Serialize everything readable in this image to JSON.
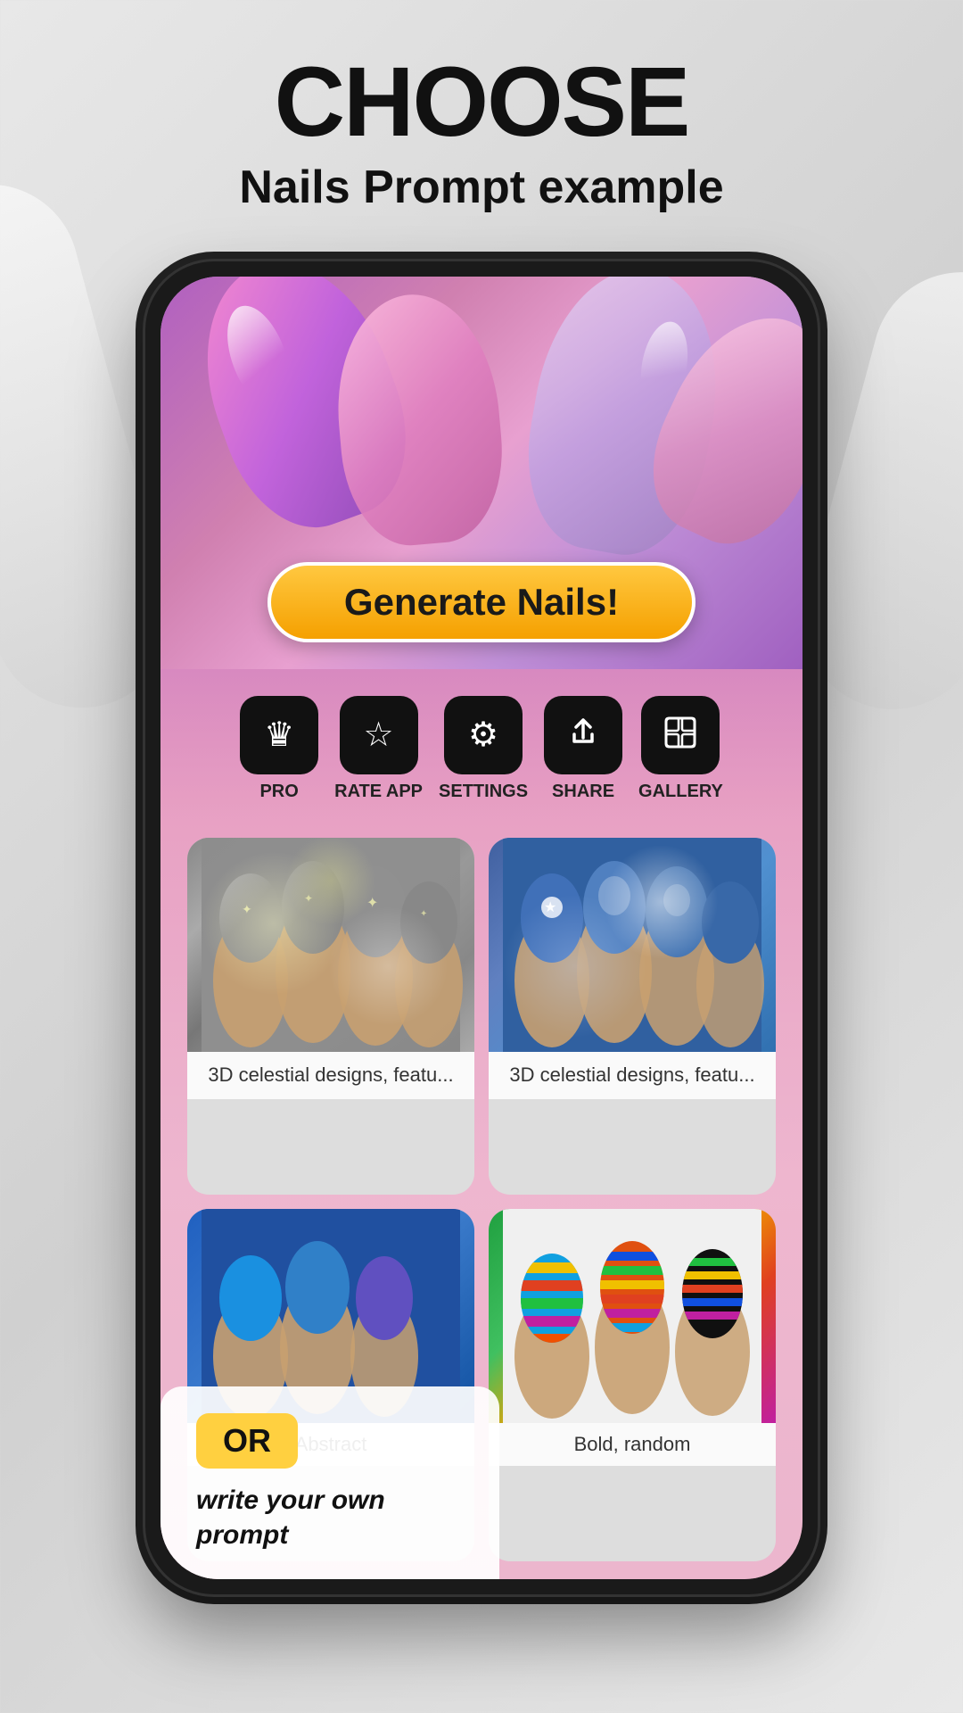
{
  "header": {
    "title": "CHOOSE",
    "subtitle": "Nails Prompt example"
  },
  "phone": {
    "generate_button": "Generate Nails!",
    "icons": [
      {
        "id": "pro",
        "label": "PRO",
        "symbol": "♛"
      },
      {
        "id": "rate-app",
        "label": "RATE APP",
        "symbol": "☆"
      },
      {
        "id": "settings",
        "label": "SETTINGS",
        "symbol": "⚙"
      },
      {
        "id": "share",
        "label": "SHARE",
        "symbol": "⬆"
      },
      {
        "id": "gallery",
        "label": "GALLERY",
        "symbol": "🖼"
      }
    ],
    "gallery_items": [
      {
        "id": "item1",
        "caption": "3D celestial designs, featu...",
        "art_class": "nail-art-1"
      },
      {
        "id": "item2",
        "caption": "3D celestial designs, featu...",
        "art_class": "nail-art-2"
      },
      {
        "id": "item3",
        "caption": "Abstract",
        "art_class": "nail-art-3"
      },
      {
        "id": "item4",
        "caption": "Bold, random",
        "art_class": "nail-art-4"
      }
    ],
    "or_card": {
      "badge": "OR",
      "description": "write your own prompt"
    },
    "bottom_left_caption": "Abstract",
    "bottom_right_caption": "Bold, random"
  },
  "colors": {
    "generate_btn_start": "#ffc840",
    "generate_btn_end": "#f5a000",
    "or_badge": "#ffd040",
    "icon_bg": "#111111"
  }
}
